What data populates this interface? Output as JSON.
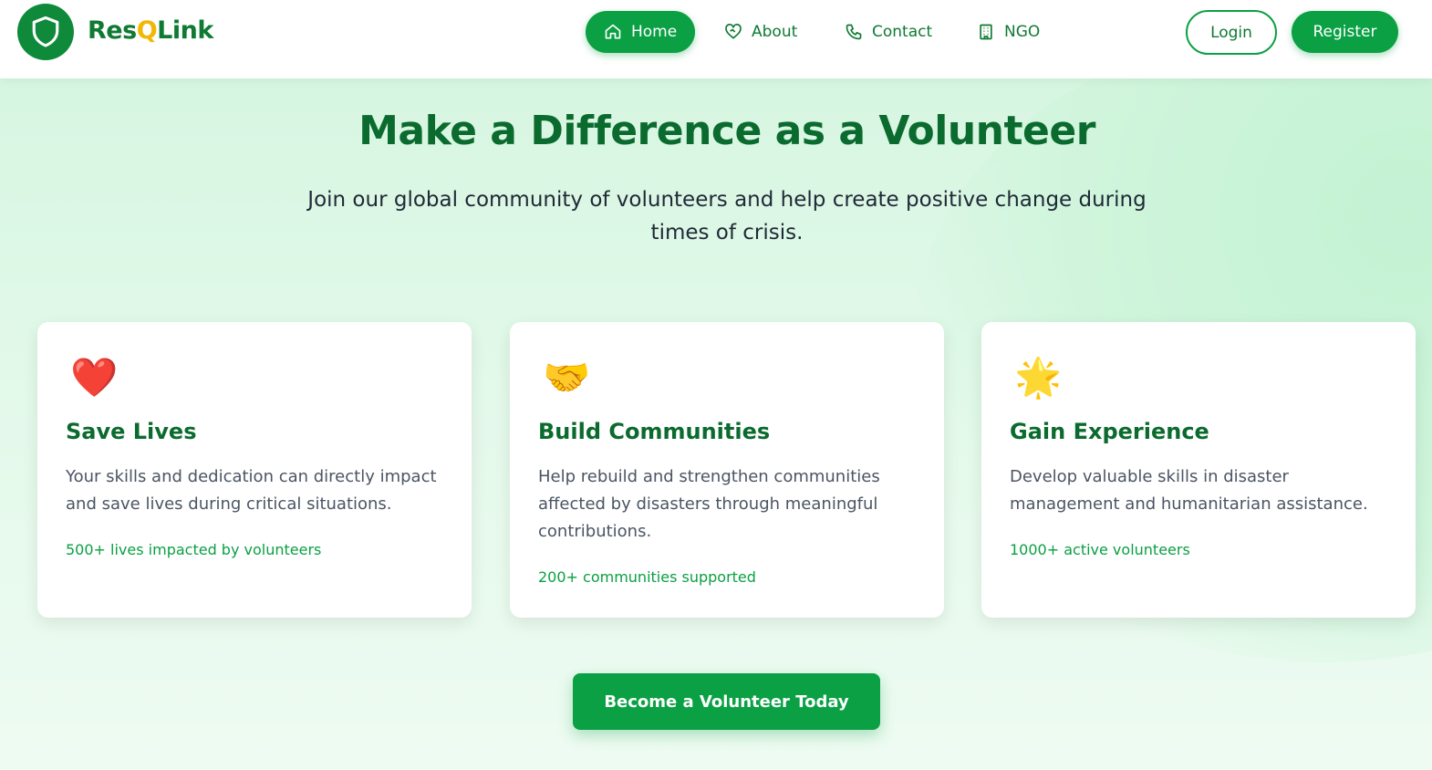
{
  "header": {
    "brand_prefix": "Res",
    "brand_q": "Q",
    "brand_suffix": "Link",
    "logo_icon": "shield-icon",
    "nav": [
      {
        "label": "Home",
        "icon": "home-icon",
        "active": true
      },
      {
        "label": "About",
        "icon": "heart-handshake-icon",
        "active": false
      },
      {
        "label": "Contact",
        "icon": "phone-icon",
        "active": false
      },
      {
        "label": "NGO",
        "icon": "building-icon",
        "active": false
      }
    ],
    "login_label": "Login",
    "register_label": "Register"
  },
  "hero": {
    "title": "Make a Difference as a Volunteer",
    "subtitle": "Join our global community of volunteers and help create positive change during times of crisis."
  },
  "cards": [
    {
      "emoji": "❤️",
      "icon": "heart-icon",
      "title": "Save Lives",
      "description": "Your skills and dedication can directly impact and save lives during critical situations.",
      "stat": "500+ lives impacted by volunteers"
    },
    {
      "emoji": "🤝",
      "icon": "handshake-icon",
      "title": "Build Communities",
      "description": "Help rebuild and strengthen communities affected by disasters through meaningful contributions.",
      "stat": "200+ communities supported"
    },
    {
      "emoji": "🌟",
      "icon": "star-icon",
      "title": "Gain Experience",
      "description": "Develop valuable skills in disaster management and humanitarian assistance.",
      "stat": "1000+ active volunteers"
    }
  ],
  "cta_label": "Become a Volunteer Today",
  "colors": {
    "primary": "#0aa043",
    "dark_green": "#0b6b2e",
    "brand_accent": "#f2b705",
    "background": "#d6f6e1"
  }
}
